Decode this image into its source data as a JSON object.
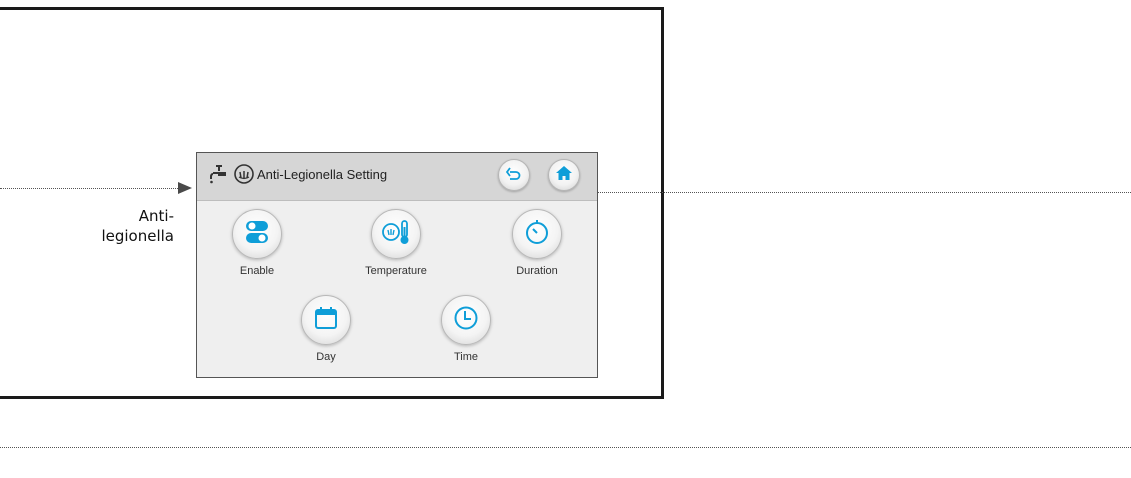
{
  "side_label": "Anti-\nlegionella",
  "screen": {
    "title": "Anti-Legionella Setting",
    "header_icons": [
      "faucet-icon",
      "legionella-icon"
    ],
    "back_button_icon": "back-arrow-icon",
    "home_button_icon": "home-icon"
  },
  "tiles": [
    {
      "label": "Enable",
      "icon": "toggle-icon"
    },
    {
      "label": "Temperature",
      "icon": "temperature-icon"
    },
    {
      "label": "Duration",
      "icon": "timer-icon"
    },
    {
      "label": "Day",
      "icon": "calendar-icon"
    },
    {
      "label": "Time",
      "icon": "clock-icon"
    }
  ],
  "colors": {
    "accent": "#0f9ed8",
    "header_bg": "#d6d6d6",
    "screen_bg": "#efefef",
    "frame": "#1a1a1a"
  }
}
